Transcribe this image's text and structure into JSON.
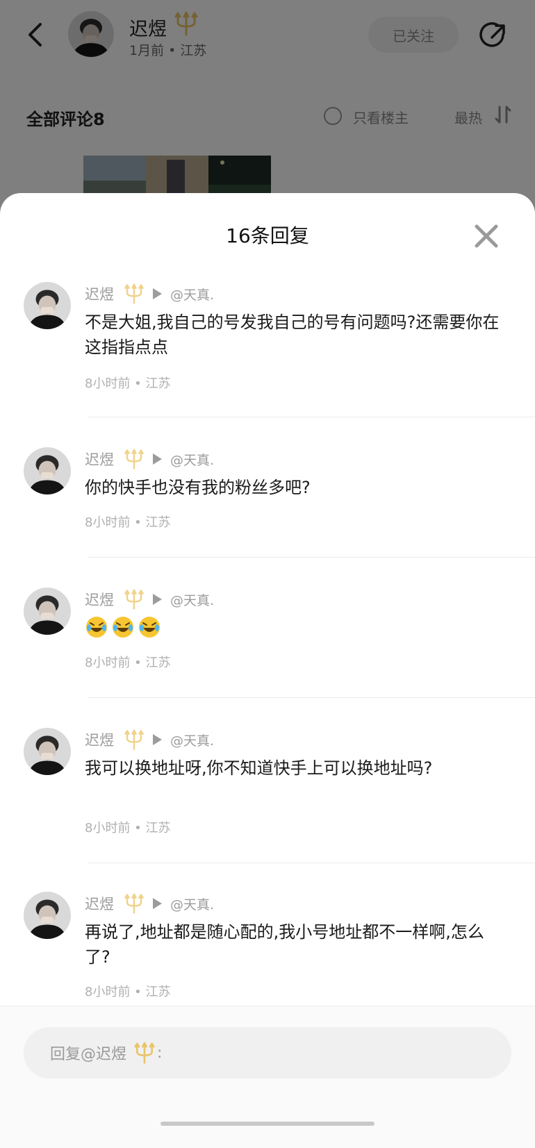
{
  "post_header": {
    "author_name": "迟煜",
    "author_meta": "1月前 • 江苏",
    "follow_label": "已关注"
  },
  "comments_bar": {
    "title": "全部评论8",
    "only_op_label": "只看楼主",
    "sort_label": "最热"
  },
  "sheet": {
    "title": "16条回复"
  },
  "replies": [
    {
      "user": "迟煜",
      "target": "@天真.",
      "text": "不是大姐,我自己的号发我自己的号有问题吗?还需要你在这指指点点",
      "time_location": "8小时前 • 江苏"
    },
    {
      "user": "迟煜",
      "target": "@天真.",
      "text": "你的快手也没有我的粉丝多吧?",
      "time_location": "8小时前 • 江苏"
    },
    {
      "user": "迟煜",
      "target": "@天真.",
      "text": "",
      "emoji": [
        "laughing-crying-emoji",
        "laughing-crying-emoji",
        "laughing-crying-emoji"
      ],
      "time_location": "8小时前 • 江苏"
    },
    {
      "user": "迟煜",
      "target": "@天真.",
      "text": "我可以换地址呀,你不知道快手上可以换地址吗?",
      "time_location": "8小时前 • 江苏"
    },
    {
      "user": "迟煜",
      "target": "@天真.",
      "text": "再说了,地址都是随心配的,我小号地址都不一样啊,怎么了?",
      "time_location": "8小时前 • 江苏"
    }
  ],
  "reply_input": {
    "prefix": "回复@迟煜",
    "suffix": ":"
  },
  "icons": {
    "back": "chevron-left-icon",
    "share": "share-icon",
    "close": "close-icon",
    "badge": "trident-badge-icon",
    "sort": "sort-icon"
  },
  "colors": {
    "badge_gold": "#e9c46a",
    "muted_text": "#9c9c9c",
    "overlay": "#7f7f7f"
  }
}
